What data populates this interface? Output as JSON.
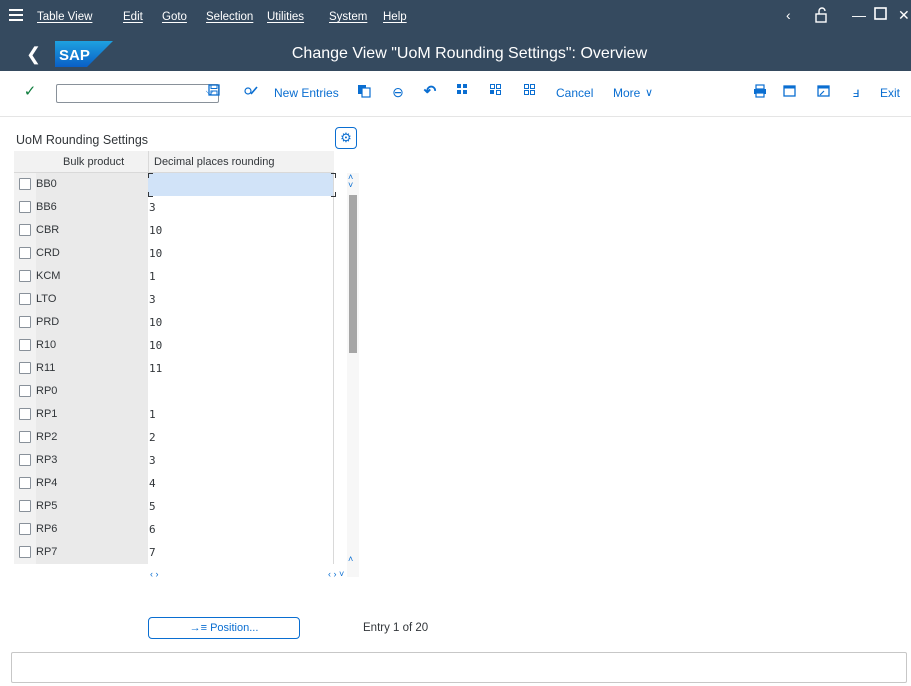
{
  "menubar": {
    "items": [
      "Table View",
      "Edit",
      "Goto",
      "Selection",
      "Utilities",
      "System",
      "Help"
    ]
  },
  "titlebar": {
    "logo": "SAP",
    "title": "Change View \"UoM Rounding Settings\": Overview"
  },
  "toolbar": {
    "new_entries": "New Entries",
    "cancel": "Cancel",
    "more": "More",
    "exit": "Exit"
  },
  "table": {
    "title": "UoM Rounding Settings",
    "columns": [
      "Bulk product UoM",
      "Decimal places rounding"
    ],
    "rows": [
      {
        "uom": "BB0",
        "decimals": ""
      },
      {
        "uom": "BB6",
        "decimals": "3"
      },
      {
        "uom": "CBR",
        "decimals": "10"
      },
      {
        "uom": "CRD",
        "decimals": "10"
      },
      {
        "uom": "KCM",
        "decimals": "1"
      },
      {
        "uom": "LTO",
        "decimals": "3"
      },
      {
        "uom": "PRD",
        "decimals": "10"
      },
      {
        "uom": "R10",
        "decimals": "10"
      },
      {
        "uom": "R11",
        "decimals": "11"
      },
      {
        "uom": "RP0",
        "decimals": ""
      },
      {
        "uom": "RP1",
        "decimals": "1"
      },
      {
        "uom": "RP2",
        "decimals": "2"
      },
      {
        "uom": "RP3",
        "decimals": "3"
      },
      {
        "uom": "RP4",
        "decimals": "4"
      },
      {
        "uom": "RP5",
        "decimals": "5"
      },
      {
        "uom": "RP6",
        "decimals": "6"
      },
      {
        "uom": "RP7",
        "decimals": "7"
      }
    ]
  },
  "footer": {
    "position_button": "Position...",
    "entry_info": "Entry 1 of 20"
  },
  "colors": {
    "shell": "#354a5f",
    "accent": "#0a6ed1",
    "confirm": "#107e3e"
  }
}
